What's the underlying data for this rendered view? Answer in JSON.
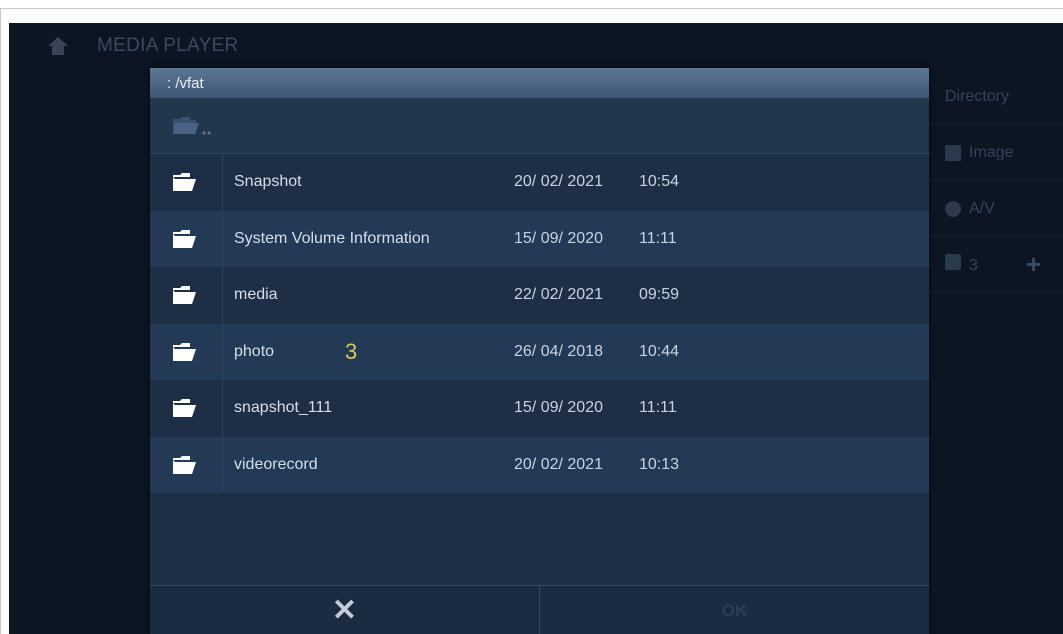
{
  "background": {
    "app_title": "MEDIA PLAYER",
    "side_menu": [
      "Directory",
      "Image",
      "A/V"
    ],
    "volume_label": "3",
    "plus_label": "+"
  },
  "dialog": {
    "path": ": /vfat",
    "up_label": "..",
    "rows": [
      {
        "name": "Snapshot",
        "date": "20/ 02/ 2021",
        "time": "10:54"
      },
      {
        "name": "System Volume Information",
        "date": "15/ 09/ 2020",
        "time": "11:11"
      },
      {
        "name": "media",
        "date": "22/ 02/ 2021",
        "time": "09:59"
      },
      {
        "name": "photo",
        "date": "26/ 04/ 2018",
        "time": "10:44",
        "annotation": "3"
      },
      {
        "name": "snapshot_111",
        "date": "15/ 09/ 2020",
        "time": "11:11"
      },
      {
        "name": "videorecord",
        "date": "20/ 02/ 2021",
        "time": "10:13"
      }
    ],
    "cancel_label": "✕",
    "ok_label": "OK"
  }
}
